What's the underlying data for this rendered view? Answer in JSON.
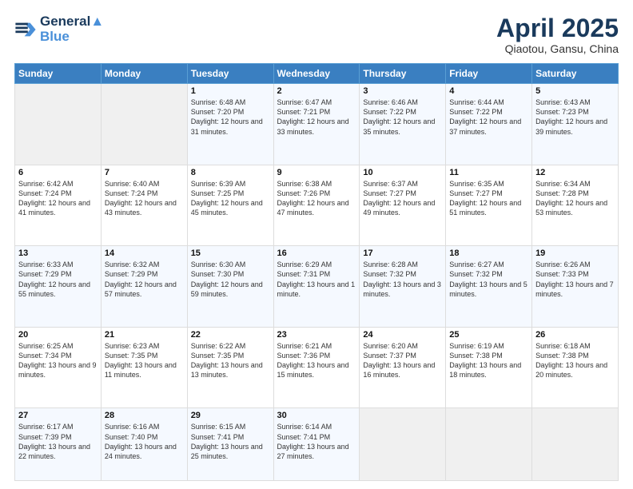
{
  "header": {
    "logo_line1": "General",
    "logo_line2": "Blue",
    "month": "April 2025",
    "location": "Qiaotou, Gansu, China"
  },
  "days_of_week": [
    "Sunday",
    "Monday",
    "Tuesday",
    "Wednesday",
    "Thursday",
    "Friday",
    "Saturday"
  ],
  "weeks": [
    [
      {
        "num": "",
        "info": ""
      },
      {
        "num": "",
        "info": ""
      },
      {
        "num": "1",
        "info": "Sunrise: 6:48 AM\nSunset: 7:20 PM\nDaylight: 12 hours and 31 minutes."
      },
      {
        "num": "2",
        "info": "Sunrise: 6:47 AM\nSunset: 7:21 PM\nDaylight: 12 hours and 33 minutes."
      },
      {
        "num": "3",
        "info": "Sunrise: 6:46 AM\nSunset: 7:22 PM\nDaylight: 12 hours and 35 minutes."
      },
      {
        "num": "4",
        "info": "Sunrise: 6:44 AM\nSunset: 7:22 PM\nDaylight: 12 hours and 37 minutes."
      },
      {
        "num": "5",
        "info": "Sunrise: 6:43 AM\nSunset: 7:23 PM\nDaylight: 12 hours and 39 minutes."
      }
    ],
    [
      {
        "num": "6",
        "info": "Sunrise: 6:42 AM\nSunset: 7:24 PM\nDaylight: 12 hours and 41 minutes."
      },
      {
        "num": "7",
        "info": "Sunrise: 6:40 AM\nSunset: 7:24 PM\nDaylight: 12 hours and 43 minutes."
      },
      {
        "num": "8",
        "info": "Sunrise: 6:39 AM\nSunset: 7:25 PM\nDaylight: 12 hours and 45 minutes."
      },
      {
        "num": "9",
        "info": "Sunrise: 6:38 AM\nSunset: 7:26 PM\nDaylight: 12 hours and 47 minutes."
      },
      {
        "num": "10",
        "info": "Sunrise: 6:37 AM\nSunset: 7:27 PM\nDaylight: 12 hours and 49 minutes."
      },
      {
        "num": "11",
        "info": "Sunrise: 6:35 AM\nSunset: 7:27 PM\nDaylight: 12 hours and 51 minutes."
      },
      {
        "num": "12",
        "info": "Sunrise: 6:34 AM\nSunset: 7:28 PM\nDaylight: 12 hours and 53 minutes."
      }
    ],
    [
      {
        "num": "13",
        "info": "Sunrise: 6:33 AM\nSunset: 7:29 PM\nDaylight: 12 hours and 55 minutes."
      },
      {
        "num": "14",
        "info": "Sunrise: 6:32 AM\nSunset: 7:29 PM\nDaylight: 12 hours and 57 minutes."
      },
      {
        "num": "15",
        "info": "Sunrise: 6:30 AM\nSunset: 7:30 PM\nDaylight: 12 hours and 59 minutes."
      },
      {
        "num": "16",
        "info": "Sunrise: 6:29 AM\nSunset: 7:31 PM\nDaylight: 13 hours and 1 minute."
      },
      {
        "num": "17",
        "info": "Sunrise: 6:28 AM\nSunset: 7:32 PM\nDaylight: 13 hours and 3 minutes."
      },
      {
        "num": "18",
        "info": "Sunrise: 6:27 AM\nSunset: 7:32 PM\nDaylight: 13 hours and 5 minutes."
      },
      {
        "num": "19",
        "info": "Sunrise: 6:26 AM\nSunset: 7:33 PM\nDaylight: 13 hours and 7 minutes."
      }
    ],
    [
      {
        "num": "20",
        "info": "Sunrise: 6:25 AM\nSunset: 7:34 PM\nDaylight: 13 hours and 9 minutes."
      },
      {
        "num": "21",
        "info": "Sunrise: 6:23 AM\nSunset: 7:35 PM\nDaylight: 13 hours and 11 minutes."
      },
      {
        "num": "22",
        "info": "Sunrise: 6:22 AM\nSunset: 7:35 PM\nDaylight: 13 hours and 13 minutes."
      },
      {
        "num": "23",
        "info": "Sunrise: 6:21 AM\nSunset: 7:36 PM\nDaylight: 13 hours and 15 minutes."
      },
      {
        "num": "24",
        "info": "Sunrise: 6:20 AM\nSunset: 7:37 PM\nDaylight: 13 hours and 16 minutes."
      },
      {
        "num": "25",
        "info": "Sunrise: 6:19 AM\nSunset: 7:38 PM\nDaylight: 13 hours and 18 minutes."
      },
      {
        "num": "26",
        "info": "Sunrise: 6:18 AM\nSunset: 7:38 PM\nDaylight: 13 hours and 20 minutes."
      }
    ],
    [
      {
        "num": "27",
        "info": "Sunrise: 6:17 AM\nSunset: 7:39 PM\nDaylight: 13 hours and 22 minutes."
      },
      {
        "num": "28",
        "info": "Sunrise: 6:16 AM\nSunset: 7:40 PM\nDaylight: 13 hours and 24 minutes."
      },
      {
        "num": "29",
        "info": "Sunrise: 6:15 AM\nSunset: 7:41 PM\nDaylight: 13 hours and 25 minutes."
      },
      {
        "num": "30",
        "info": "Sunrise: 6:14 AM\nSunset: 7:41 PM\nDaylight: 13 hours and 27 minutes."
      },
      {
        "num": "",
        "info": ""
      },
      {
        "num": "",
        "info": ""
      },
      {
        "num": "",
        "info": ""
      }
    ]
  ]
}
